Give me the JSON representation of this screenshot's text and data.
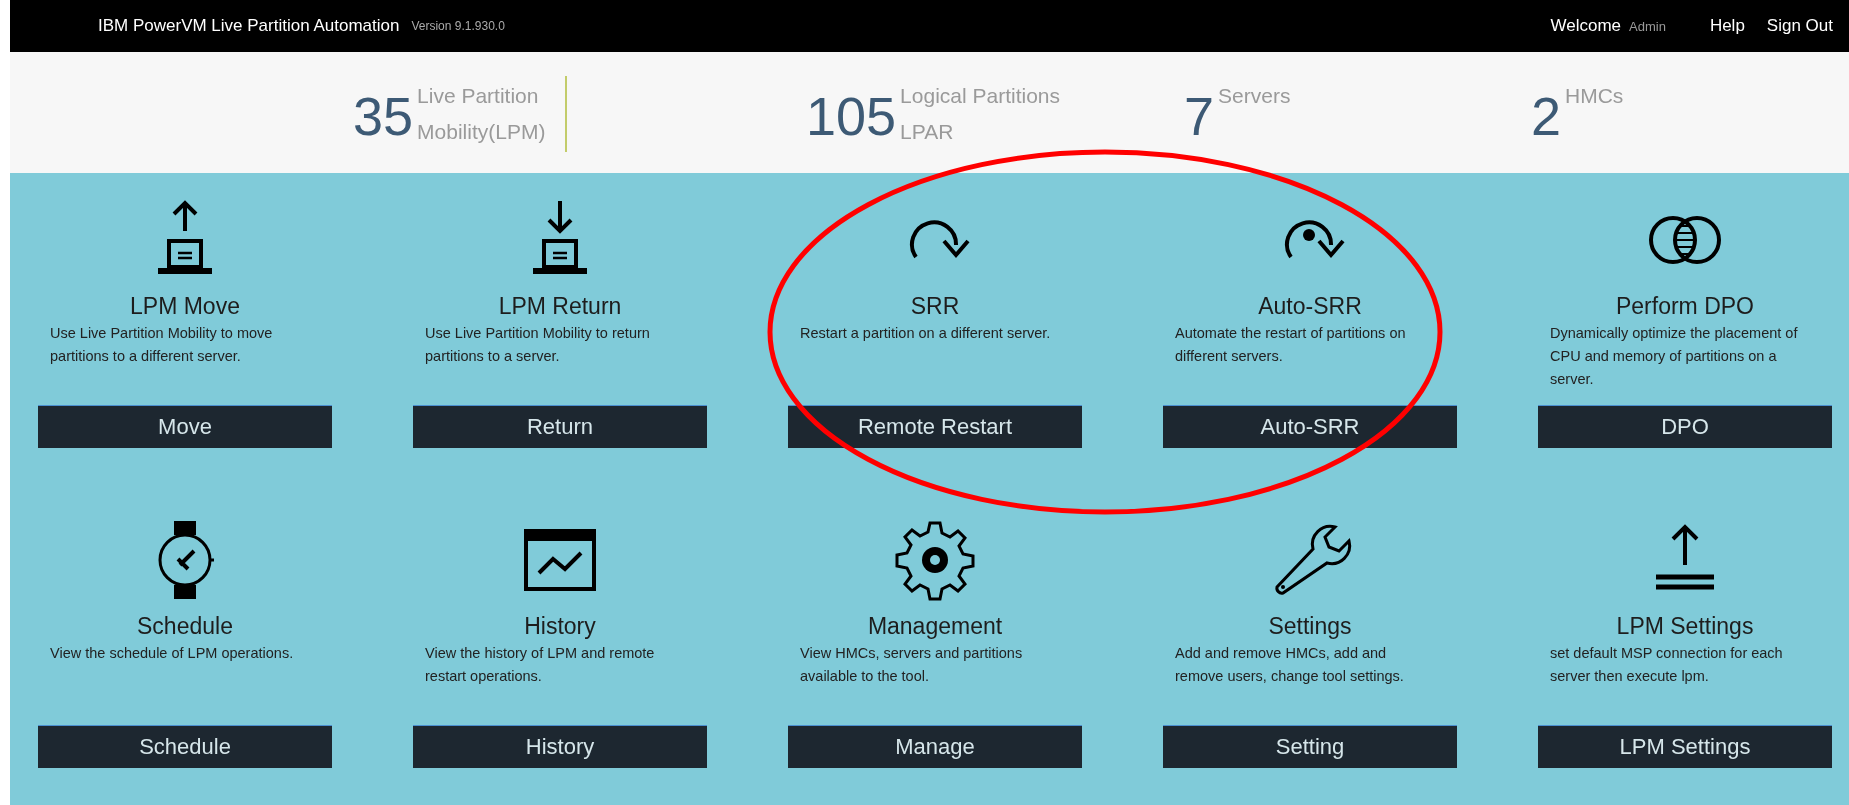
{
  "header": {
    "title": "IBM PowerVM Live Partition Automation",
    "version": "Version 9.1.930.0",
    "welcome": "Welcome",
    "user": "Admin",
    "links": [
      "Help",
      "Sign Out"
    ]
  },
  "stats": [
    {
      "value": "35",
      "label": [
        "Live Partition",
        "Mobility(LPM)"
      ],
      "divider": true
    },
    {
      "value": "105",
      "label": [
        "Logical Partitions",
        "LPAR"
      ],
      "divider": false
    },
    {
      "value": "7",
      "label": [
        "Servers"
      ],
      "divider": false
    },
    {
      "value": "2",
      "label": [
        "HMCs"
      ],
      "divider": false
    }
  ],
  "tiles": [
    {
      "kind": "move",
      "title": "LPM Move",
      "description": "Use Live Partition Mobility to move partitions to a different server.",
      "button": "Move"
    },
    {
      "kind": "return",
      "title": "LPM Return",
      "description": "Use Live Partition Mobility to return partitions to a server.",
      "button": "Return"
    },
    {
      "kind": "srr",
      "title": "SRR",
      "description": "Restart a partition on a different server.",
      "button": "Remote Restart"
    },
    {
      "kind": "autosrr",
      "title": "Auto-SRR",
      "description": "Automate the restart of partitions on different servers.",
      "button": "Auto-SRR"
    },
    {
      "kind": "dpo",
      "title": "Perform DPO",
      "description": "Dynamically optimize the placement of CPU and memory of partitions on a server.",
      "button": "DPO"
    },
    {
      "kind": "schedule",
      "title": "Schedule",
      "description": "View the schedule of LPM operations.",
      "button": "Schedule"
    },
    {
      "kind": "history",
      "title": "History",
      "description": "View the history of LPM and remote restart operations.",
      "button": "History"
    },
    {
      "kind": "manage",
      "title": "Management",
      "description": "View HMCs, servers and partitions available to the tool.",
      "button": "Manage"
    },
    {
      "kind": "settings",
      "title": "Settings",
      "description": "Add and remove HMCs, add and remove users, change tool settings.",
      "button": "Setting"
    },
    {
      "kind": "lpmsettings",
      "title": "LPM Settings",
      "description": "set default MSP connection for each server then execute lpm.",
      "button": "LPM Settings"
    }
  ],
  "annotation": {
    "kind": "ellipse",
    "color": "#ff0000"
  }
}
